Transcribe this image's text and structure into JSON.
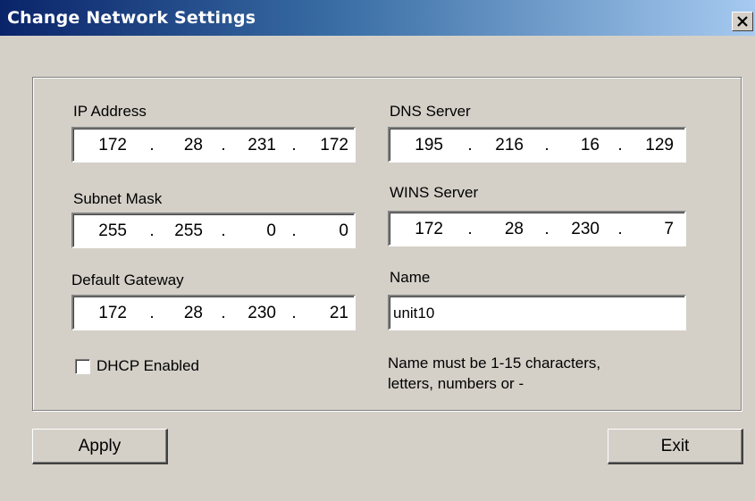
{
  "window": {
    "title": "Change Network Settings",
    "close_icon": "close-icon"
  },
  "ip_address": {
    "label": "IP Address",
    "octets": [
      "172",
      "28",
      "231",
      "172"
    ]
  },
  "subnet_mask": {
    "label": "Subnet Mask",
    "octets": [
      "255",
      "255",
      "0",
      "0"
    ]
  },
  "default_gateway": {
    "label": "Default Gateway",
    "octets": [
      "172",
      "28",
      "230",
      "21"
    ]
  },
  "dns_server": {
    "label": "DNS Server",
    "octets": [
      "195",
      "216",
      "16",
      "129"
    ]
  },
  "wins_server": {
    "label": "WINS Server",
    "octets": [
      "172",
      "28",
      "230",
      "7"
    ]
  },
  "name": {
    "label": "Name",
    "value": "unit10",
    "hint_line1": "Name must be 1-15 characters,",
    "hint_line2": "letters, numbers or -"
  },
  "dhcp": {
    "label": "DHCP Enabled",
    "checked": false
  },
  "buttons": {
    "apply": "Apply",
    "exit": "Exit"
  }
}
